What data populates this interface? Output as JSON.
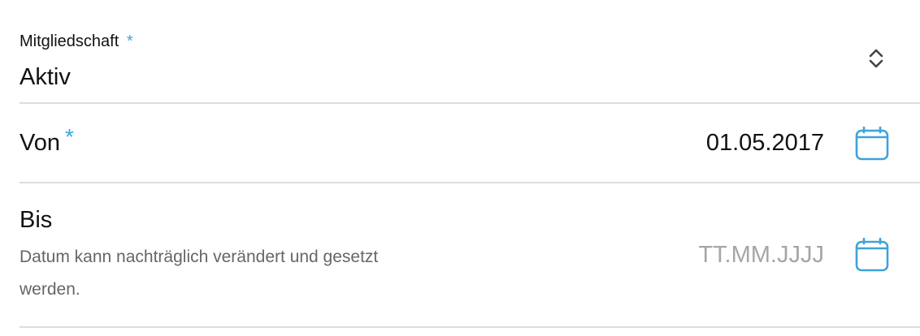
{
  "membership": {
    "label": "Mitgliedschaft",
    "required_marker": "*",
    "value": "Aktiv",
    "icon": "select-arrows-icon"
  },
  "from": {
    "label": "Von",
    "required_marker": "*",
    "value": "01.05.2017",
    "icon": "calendar-icon"
  },
  "until": {
    "label": "Bis",
    "hint": "Datum kann nachträglich verändert und gesetzt werden.",
    "placeholder": "TT.MM.JJJJ",
    "icon": "calendar-icon"
  },
  "colors": {
    "accent": "#3ea3d8",
    "divider": "#dddddd",
    "placeholder": "#a6a6a6",
    "hint": "#666666"
  }
}
